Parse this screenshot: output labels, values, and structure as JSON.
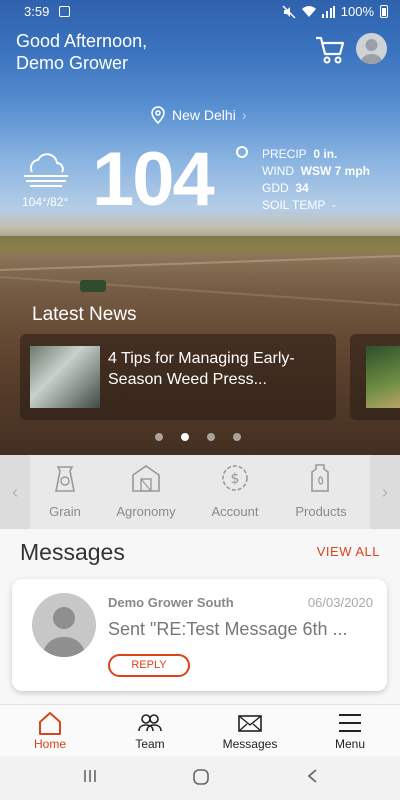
{
  "status": {
    "time": "3:59",
    "battery": "100%"
  },
  "header": {
    "greeting_line1": "Good Afternoon,",
    "greeting_line2": "Demo Grower"
  },
  "weather": {
    "location": "New Delhi",
    "temperature": "104",
    "hi_lo": "104°/82°",
    "precip_label": "PRECIP",
    "precip_value": "0 in.",
    "wind_label": "WIND",
    "wind_value": "WSW 7 mph",
    "gdd_label": "GDD",
    "gdd_value": "34",
    "soil_label": "SOIL TEMP",
    "soil_value": "-"
  },
  "news": {
    "title": "Latest News",
    "items": [
      {
        "title": "4 Tips for Managing Early-Season Weed Press..."
      }
    ],
    "page_count": 4,
    "active_page": 1
  },
  "categories": [
    {
      "label": "Grain",
      "icon": "grain-bag-icon"
    },
    {
      "label": "Agronomy",
      "icon": "barn-icon"
    },
    {
      "label": "Account",
      "icon": "dollar-icon"
    },
    {
      "label": "Products",
      "icon": "jug-icon"
    }
  ],
  "messages": {
    "title": "Messages",
    "view_all": "VIEW ALL",
    "items": [
      {
        "from": "Demo Grower South",
        "date": "06/03/2020",
        "preview": "Sent \"RE:Test Message 6th ...",
        "reply_label": "REPLY"
      }
    ]
  },
  "nav": [
    {
      "label": "Home",
      "icon": "home-icon",
      "active": true
    },
    {
      "label": "Team",
      "icon": "team-icon"
    },
    {
      "label": "Messages",
      "icon": "envelope-icon"
    },
    {
      "label": "Menu",
      "icon": "hamburger-icon"
    }
  ],
  "colors": {
    "accent": "#d9441b"
  }
}
